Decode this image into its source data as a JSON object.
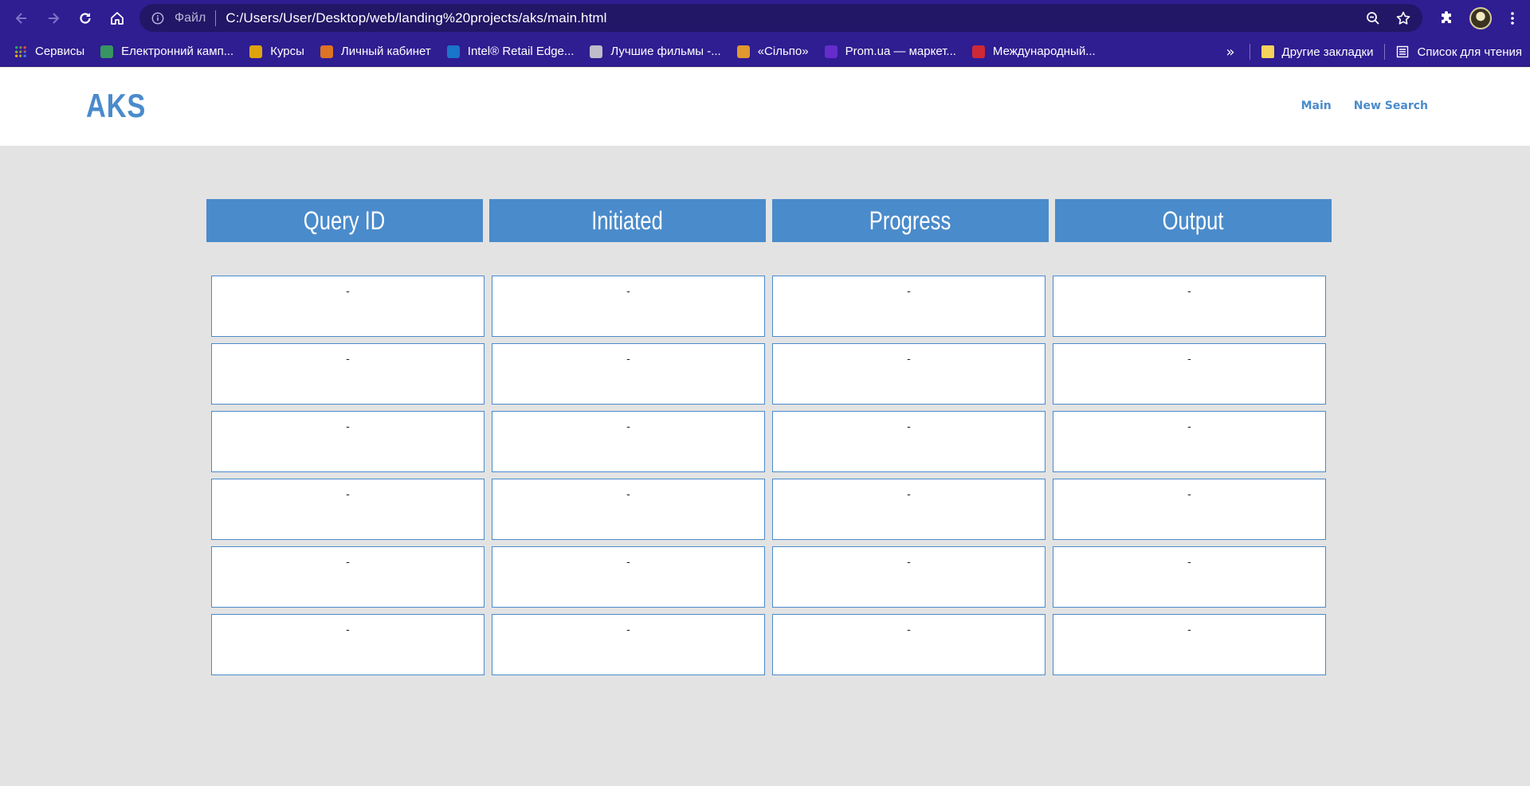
{
  "browser": {
    "omnibox": {
      "scheme_label": "Файл",
      "url": "C:/Users/User/Desktop/web/landing%20projects/aks/main.html"
    },
    "bookmarks": [
      {
        "label": "Сервисы",
        "icon": "apps-grid-icon",
        "color": "#e34c3c"
      },
      {
        "label": "Електронний камп...",
        "icon": "graduation-cap-icon",
        "color": "#3aa35c"
      },
      {
        "label": "Курсы",
        "icon": "classroom-icon",
        "color": "#f2b400"
      },
      {
        "label": "Личный кабинет",
        "icon": "m-logo-icon",
        "color": "#f07d1a"
      },
      {
        "label": "Intel® Retail Edge...",
        "icon": "intel-logo-icon",
        "color": "#1a7fd0"
      },
      {
        "label": "Лучшие фильмы -...",
        "icon": "hd-icon",
        "color": "#cfcfcf"
      },
      {
        "label": "«Сільпо»",
        "icon": "silpo-logo-icon",
        "color": "#f5a623"
      },
      {
        "label": "Prom.ua — маркет...",
        "icon": "prom-logo-icon",
        "color": "#6b2fd1"
      },
      {
        "label": "Международный...",
        "icon": "network-logo-icon",
        "color": "#e02b2b"
      }
    ],
    "bookmarks_overflow": "»",
    "other_bookmarks": "Другие закладки",
    "reading_list": "Список для чтения"
  },
  "site": {
    "logo": "AKS",
    "nav": {
      "main": "Main",
      "new_search": "New Search"
    },
    "accent_color": "#4a8bcb"
  },
  "table": {
    "columns": [
      "Query ID",
      "Initiated",
      "Progress",
      "Output"
    ],
    "rows": [
      [
        "-",
        "-",
        "-",
        "-"
      ],
      [
        "-",
        "-",
        "-",
        "-"
      ],
      [
        "-",
        "-",
        "-",
        "-"
      ],
      [
        "-",
        "-",
        "-",
        "-"
      ],
      [
        "-",
        "-",
        "-",
        "-"
      ],
      [
        "-",
        "-",
        "-",
        "-"
      ]
    ]
  }
}
